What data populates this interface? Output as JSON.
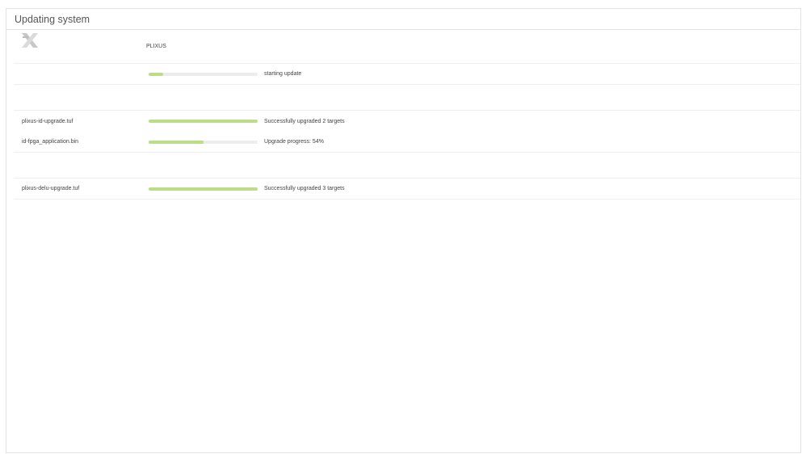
{
  "window": {
    "title": "Updating system"
  },
  "header": {
    "brand": "PLIXUS",
    "logo_icon": "plixus-x-logo"
  },
  "overall": {
    "progress_fraction": 0.13,
    "status": "starting update"
  },
  "groups": [
    {
      "items": [
        {
          "name": "plixus-id-upgrade.tuf",
          "progress_fraction": 1.0,
          "status": "Successfully upgraded 2 targets"
        },
        {
          "name": "id-fpga_application.bin",
          "progress_fraction": 0.5,
          "status": "Upgrade progress: 54%"
        }
      ]
    },
    {
      "items": [
        {
          "name": "plixus-delu-upgrade.tuf",
          "progress_fraction": 1.0,
          "status": "Successfully upgraded 3 targets"
        }
      ]
    }
  ],
  "colors": {
    "progress_fill": "#bcdc86",
    "progress_track": "#ececec",
    "border": "#e3e3e3"
  }
}
